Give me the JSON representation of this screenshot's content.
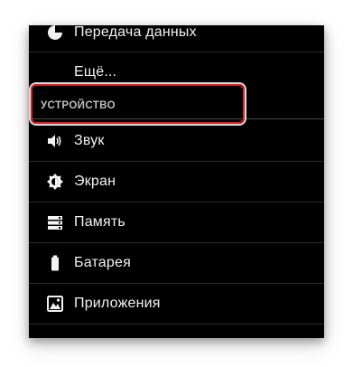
{
  "settings": {
    "items": {
      "data_usage": {
        "label": "Передача данных",
        "icon": "data-usage-icon"
      },
      "more": {
        "label": "Ещё..."
      },
      "device_header": {
        "label": "УСТРОЙСТВО"
      },
      "sound": {
        "label": "Звук",
        "icon": "volume-icon"
      },
      "display": {
        "label": "Экран",
        "icon": "brightness-icon"
      },
      "storage": {
        "label": "Память",
        "icon": "storage-icon"
      },
      "battery": {
        "label": "Батарея",
        "icon": "battery-icon"
      },
      "apps": {
        "label": "Приложения",
        "icon": "apps-icon"
      }
    },
    "colors": {
      "background": "#000000",
      "text": "#f2f2f2",
      "section_header_text": "#bfbfbf",
      "highlight_border": "#d4212b"
    }
  }
}
